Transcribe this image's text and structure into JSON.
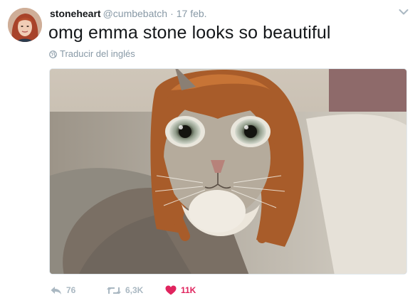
{
  "tweet": {
    "name": "stoneheart",
    "handle": "@cumbebatch",
    "separator": "·",
    "date": "17 feb.",
    "text": "omg emma stone looks so beautiful",
    "translate_label": "Traducir del inglés",
    "media": {
      "icon": "cat-with-wig-photo"
    },
    "actions": {
      "reply_count": "76",
      "retweet_count": "6,3K",
      "like_count": "11K",
      "like_color": "#e0245e",
      "inactive_color": "#aab8c2"
    }
  }
}
